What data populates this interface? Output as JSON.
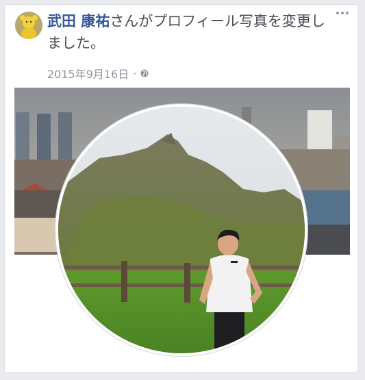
{
  "post": {
    "author_name": "武田 康祐",
    "action_text": "さんがプロフィール写真を変更しました。",
    "date": "2015年9月16日",
    "separator": "·"
  },
  "icons": {
    "more": "more-options-icon",
    "audience": "globe-icon"
  },
  "colors": {
    "author_link": "#365899",
    "meta_text": "#90949c",
    "body_text": "#4b4f56"
  }
}
